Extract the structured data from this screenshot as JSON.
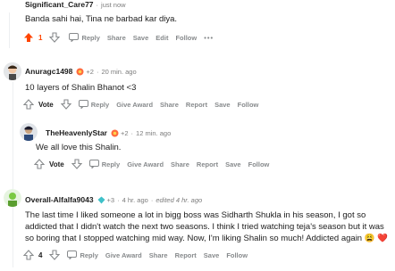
{
  "comments": [
    {
      "username": "Significant_Care77",
      "sep": "·",
      "time": "just now",
      "text": "Banda sahi hai, Tina ne barbad kar diya.",
      "vote": "1",
      "actions": {
        "reply": "Reply",
        "share": "Share",
        "save": "Save",
        "edit": "Edit",
        "follow": "Follow",
        "more": "•••"
      },
      "upvoted": true
    },
    {
      "username": "Anuragc1498",
      "flair": "+2",
      "sep": "·",
      "time": "20 min. ago",
      "text": "10 layers of Shalin Bhanot <3",
      "vote": "Vote",
      "actions": {
        "reply": "Reply",
        "give_award": "Give Award",
        "share": "Share",
        "report": "Report",
        "save": "Save",
        "follow": "Follow"
      }
    },
    {
      "username": "TheHeavenlyStar",
      "flair": "+2",
      "sep": "·",
      "time": "12 min. ago",
      "text": "We all love this Shalin.",
      "vote": "Vote",
      "actions": {
        "reply": "Reply",
        "give_award": "Give Award",
        "share": "Share",
        "report": "Report",
        "save": "Save",
        "follow": "Follow"
      }
    },
    {
      "username": "Overall-Alfalfa9043",
      "flair": "+3",
      "sep": "·",
      "time": "4 hr. ago",
      "sep2": "·",
      "edited": "edited 4 hr. ago",
      "text": "The last time I liked someone a lot in bigg boss was Sidharth Shukla in his season, I got so addicted that I didn't watch the next two seasons. I think I tried watching teja's season but it was so boring that I stopped watching mid way. Now, I'm liking Shalin so much! Addicted again 😩 ❤️",
      "vote": "4",
      "actions": {
        "reply": "Reply",
        "give_award": "Give Award",
        "share": "Share",
        "report": "Report",
        "save": "Save",
        "follow": "Follow"
      }
    }
  ],
  "colors": {
    "upvote": "#ff4500",
    "meta": "#7c7c7c",
    "action": "#878a8c",
    "thread": "#edeff1"
  }
}
